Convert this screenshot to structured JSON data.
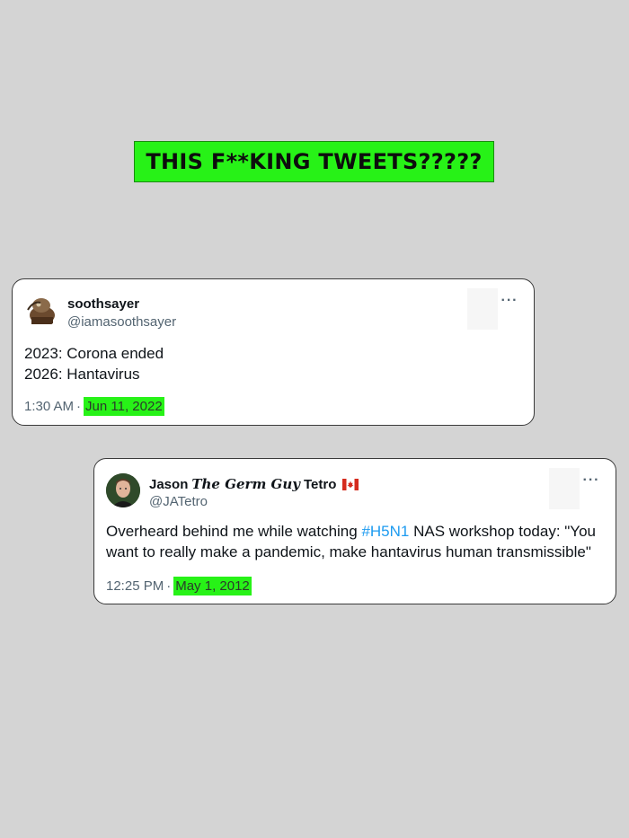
{
  "headline": "THIS F**KING TWEETS?????",
  "tweets": [
    {
      "display_name": "soothsayer",
      "handle": "@iamasoothsayer",
      "lines": [
        "2023: Corona ended",
        "2026: Hantavirus"
      ],
      "time": "1:30 AM",
      "separator": "·",
      "date": "Jun 11, 2022",
      "more_icon": "more-horizontal-icon"
    },
    {
      "display_name_first": "Jason",
      "display_name_italic": "The Germ Guy",
      "display_name_last": "Tetro",
      "flag_icon": "canada-flag-icon",
      "handle": "@JATetro",
      "line1_before": "Overheard behind me while watching ",
      "line1_hashtag": "#H5N1",
      "line1_after": " NAS workshop today: \"You",
      "line2": "want to really make a pandemic, make hantavirus human transmissible\"",
      "time": "12:25 PM",
      "separator": "·",
      "date": "May 1, 2012",
      "more_icon": "more-horizontal-icon"
    }
  ],
  "colors": {
    "background": "#d4d4d4",
    "highlight": "#27f217",
    "hashtag": "#1d9bf0",
    "muted_text": "#536471"
  }
}
